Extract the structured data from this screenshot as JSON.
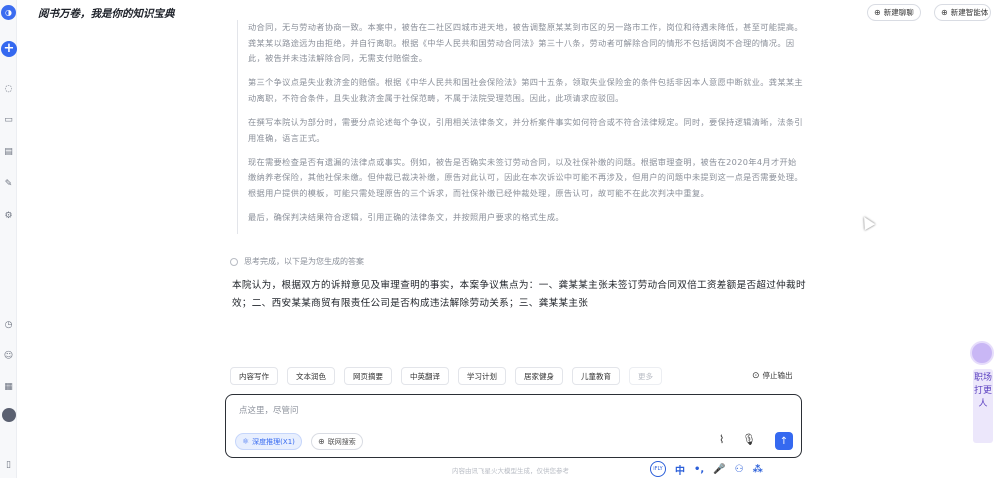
{
  "app": {
    "title": "阅书万卷，我是你的知识宝典"
  },
  "header": {
    "new_chat_label": "新建聊聊",
    "new_agent_label": "新建智能体"
  },
  "thinking": {
    "paragraphs": [
      "动合同，无与劳动者协商一致。本案中，被告在二社区四城市进天地，被告调整原某某到市区的另一路市工作，岗位和待遇未降低，甚至可能提高。龚某某以路途远为由拒绝，并自行离职。根据《中华人民共和国劳动合同法》第三十八条，劳动者可解除合同的情形不包括调岗不合理的情况。因此，被告并未违法解除合同，无需支付赔偿金。",
      "第三个争议点是失业救济金的赔偿。根据《中华人民共和国社会保险法》第四十五条，领取失业保险金的条件包括非因本人意愿中断就业。龚某某主动离职，不符合条件，且失业救济金属于社保范畴，不属于法院受理范围。因此，此项请求应驳回。",
      "在撰写本院认为部分时，需要分点论述每个争议，引用相关法律条文，并分析案件事实如何符合或不符合法律规定。同时，要保持逻辑清晰，法条引用准确，语言正式。",
      "现在需要检查是否有遗漏的法律点或事实。例如，被告是否确实未签订劳动合同，以及社保补缴的问题。根据审理查明，被告在2020年4月才开始缴纳养老保险，其他社保未缴。但仲裁已裁决补缴，原告对此认可，因此在本次诉讼中可能不再涉及，但用户的问题中未提到这一点是否需要处理。根据用户提供的模板，可能只需处理原告的三个诉求，而社保补缴已经仲裁处理，原告认可，故可能不在此次判决中重复。",
      "最后，确保判决结果符合逻辑，引用正确的法律条文，并按照用户要求的格式生成。"
    ],
    "done_label": "思考完成，以下是为您生成的答案"
  },
  "answer": {
    "text": "本院认为，根据双方的诉辩意见及审理查明的事实，本案争议焦点为：一、龚某某主张未签订劳动合同双倍工资差额是否超过仲裁时效；二、西安某某商贸有限责任公司是否构成违法解除劳动关系；三、龚某某主张"
  },
  "chips": [
    {
      "label": "内容写作"
    },
    {
      "label": "文本润色"
    },
    {
      "label": "网页摘要"
    },
    {
      "label": "中英翻译"
    },
    {
      "label": "学习计划"
    },
    {
      "label": "居家健身"
    },
    {
      "label": "儿童教育"
    },
    {
      "label": "更多"
    }
  ],
  "stop_label": "停止输出",
  "input": {
    "placeholder": "点这里，尽管问",
    "deep_label": "深度推理(X1)",
    "net_label": "联网搜索"
  },
  "disclaimer": "内容由讯飞星火大模型生成，仅供您参考",
  "ime": {
    "items": [
      "中",
      "•,",
      "🎤",
      "⚇",
      "⁂"
    ]
  },
  "widget": {
    "text": "职场打更人"
  },
  "icons": {
    "logo": "app-logo-icon",
    "add": "plus-icon",
    "accent": "#3569f0"
  }
}
